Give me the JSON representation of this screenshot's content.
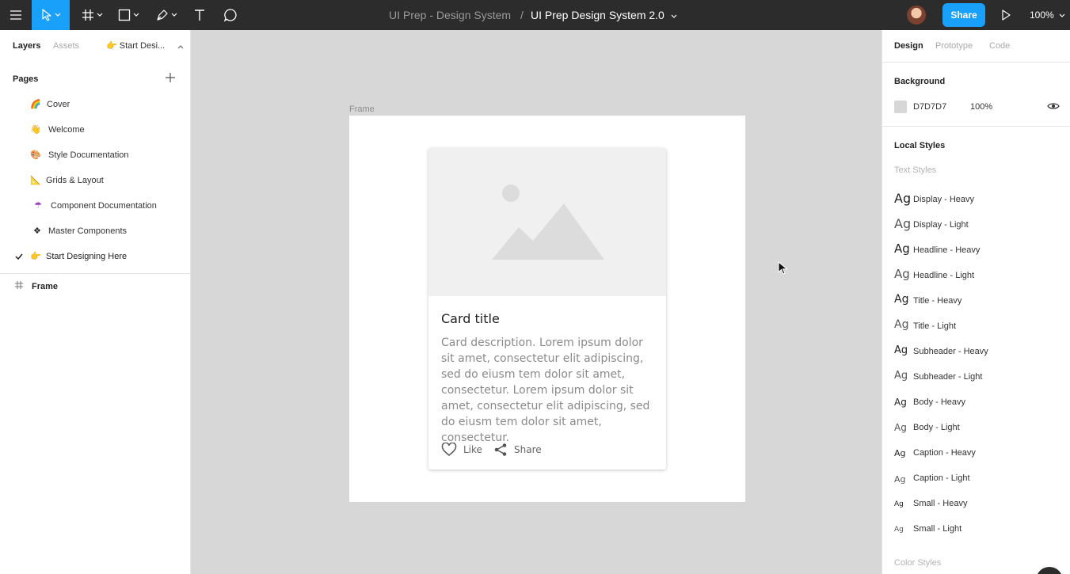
{
  "toolbar": {
    "project": "UI Prep - Design System",
    "separator": "/",
    "file_name": "UI Prep Design System 2.0",
    "share_label": "Share",
    "zoom": "100%"
  },
  "left_panel": {
    "tabs": [
      "Layers",
      "Assets"
    ],
    "current_page": "👉 Start Desi...",
    "pages_heading": "Pages",
    "pages": [
      {
        "emoji": "🌈",
        "label": "Cover"
      },
      {
        "emoji": "👋",
        "label": "Welcome"
      },
      {
        "emoji": "🎨",
        "label": "Style Documentation"
      },
      {
        "emoji": "📐",
        "label": "Grids & Layout"
      },
      {
        "emoji": "☂",
        "label": "Component Documentation"
      },
      {
        "emoji": "❖",
        "label": "Master Components"
      },
      {
        "emoji": "👉",
        "label": "Start Designing Here",
        "selected": true
      }
    ],
    "layers": [
      {
        "label": "Frame"
      }
    ]
  },
  "canvas": {
    "frame_label": "Frame",
    "card": {
      "title": "Card title",
      "description": "Card description. Lorem ipsum dolor sit amet, consectetur elit adipiscing, sed do eiusm tem dolor sit amet, consectetur. Lorem ipsum dolor sit amet, consectetur elit adipiscing, sed do eiusm tem dolor sit amet, consectetur.",
      "like_label": "Like",
      "share_label": "Share"
    }
  },
  "right_panel": {
    "tabs": [
      "Design",
      "Prototype",
      "Code"
    ],
    "background_heading": "Background",
    "background_hex": "D7D7D7",
    "background_opacity": "100%",
    "local_styles_heading": "Local Styles",
    "text_styles_heading": "Text Styles",
    "text_styles": [
      {
        "ag": "Ag",
        "label": "Display - Heavy"
      },
      {
        "ag": "Ag",
        "label": "Display - Light"
      },
      {
        "ag": "Ag",
        "label": "Headline - Heavy"
      },
      {
        "ag": "Ag",
        "label": "Headline - Light"
      },
      {
        "ag": "Ag",
        "label": "Title - Heavy"
      },
      {
        "ag": "Ag",
        "label": "Title - Light"
      },
      {
        "ag": "Ag",
        "label": "Subheader - Heavy"
      },
      {
        "ag": "Ag",
        "label": "Subheader - Light"
      },
      {
        "ag": "Ag",
        "label": "Body - Heavy"
      },
      {
        "ag": "Ag",
        "label": "Body - Light"
      },
      {
        "ag": "Ag",
        "label": "Caption - Heavy"
      },
      {
        "ag": "Ag",
        "label": "Caption - Light"
      },
      {
        "ag": "Ag",
        "label": "Small - Heavy"
      },
      {
        "ag": "Ag",
        "label": "Small - Light"
      }
    ],
    "color_styles_heading": "Color Styles"
  },
  "colors": {
    "toolbar_bg": "#2c2c2c",
    "accent": "#18a0fb",
    "canvas_bg": "#d7d7d7"
  }
}
